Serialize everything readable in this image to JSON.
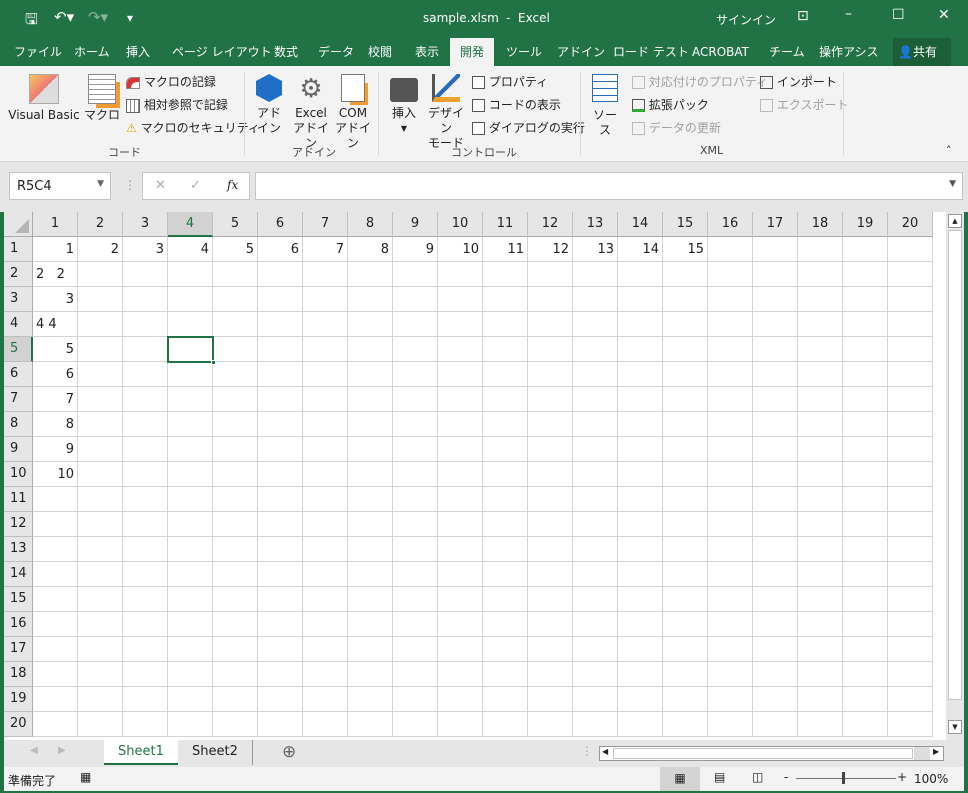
{
  "title": {
    "file": "sample.xlsm",
    "sep": "-",
    "app": "Excel",
    "signin": "サインイン"
  },
  "qat": {
    "save": "save-icon",
    "undo": "undo-icon",
    "redo": "redo-icon",
    "customize": "▾"
  },
  "tabs": [
    "ファイル",
    "ホーム",
    "挿入",
    "ページ レイアウト",
    "数式",
    "データ",
    "校閲",
    "表示",
    "開発",
    "ツール",
    "アドイン",
    "ロード テスト",
    "ACROBAT",
    "チーム",
    "操作アシス"
  ],
  "active_tab": "開発",
  "share": "共有",
  "ribbon": {
    "code": {
      "label": "コード",
      "visual_basic": "Visual Basic",
      "macro": "マクロ",
      "record": "マクロの記録",
      "relative": "相対参照で記録",
      "security": "マクロのセキュリティ"
    },
    "addins": {
      "label": "アドイン",
      "addin": [
        "アド",
        "イン"
      ],
      "excel_addin": [
        "Excel",
        "アドイン"
      ],
      "com_addin": [
        "COM",
        "アドイン"
      ]
    },
    "controls": {
      "label": "コントロール",
      "insert": "挿入",
      "design": [
        "デザイン",
        "モード"
      ],
      "properties": "プロパティ",
      "view_code": "コードの表示",
      "dialog": "ダイアログの実行"
    },
    "xml": {
      "label": "XML",
      "source": "ソース",
      "map_props": "対応付けのプロパティ",
      "expansion": "拡張パック",
      "refresh": "データの更新",
      "import": "インポート",
      "export": "エクスポート"
    }
  },
  "formula_bar": {
    "name_box": "R5C4",
    "fx": "fx",
    "cancel": "✕",
    "enter": "✓",
    "value": ""
  },
  "grid": {
    "columns": [
      "1",
      "2",
      "3",
      "4",
      "5",
      "6",
      "7",
      "8",
      "9",
      "10",
      "11",
      "12",
      "13",
      "14",
      "15",
      "16",
      "17",
      "18",
      "19",
      "20"
    ],
    "rows": [
      "1",
      "2",
      "3",
      "4",
      "5",
      "6",
      "7",
      "8",
      "9",
      "10",
      "11",
      "12",
      "13",
      "14",
      "15",
      "16",
      "17",
      "18",
      "19",
      "20"
    ],
    "selected": {
      "row": 5,
      "col": 4
    },
    "cells": [
      {
        "r": 1,
        "c": 1,
        "v": "1",
        "type": "num"
      },
      {
        "r": 1,
        "c": 2,
        "v": "2",
        "type": "num"
      },
      {
        "r": 1,
        "c": 3,
        "v": "3",
        "type": "num"
      },
      {
        "r": 1,
        "c": 4,
        "v": "4",
        "type": "num"
      },
      {
        "r": 1,
        "c": 5,
        "v": "5",
        "type": "num"
      },
      {
        "r": 1,
        "c": 6,
        "v": "6",
        "type": "num"
      },
      {
        "r": 1,
        "c": 7,
        "v": "7",
        "type": "num"
      },
      {
        "r": 1,
        "c": 8,
        "v": "8",
        "type": "num"
      },
      {
        "r": 1,
        "c": 9,
        "v": "9",
        "type": "num"
      },
      {
        "r": 1,
        "c": 10,
        "v": "10",
        "type": "num"
      },
      {
        "r": 1,
        "c": 11,
        "v": "11",
        "type": "num"
      },
      {
        "r": 1,
        "c": 12,
        "v": "12",
        "type": "num"
      },
      {
        "r": 1,
        "c": 13,
        "v": "13",
        "type": "num"
      },
      {
        "r": 1,
        "c": 14,
        "v": "14",
        "type": "num"
      },
      {
        "r": 1,
        "c": 15,
        "v": "15",
        "type": "num"
      },
      {
        "r": 2,
        "c": 1,
        "v": "2   2",
        "type": "text"
      },
      {
        "r": 3,
        "c": 1,
        "v": "3",
        "type": "num"
      },
      {
        "r": 4,
        "c": 1,
        "v": "4 4",
        "type": "text"
      },
      {
        "r": 5,
        "c": 1,
        "v": "5",
        "type": "num"
      },
      {
        "r": 6,
        "c": 1,
        "v": "6",
        "type": "num"
      },
      {
        "r": 7,
        "c": 1,
        "v": "7",
        "type": "num"
      },
      {
        "r": 8,
        "c": 1,
        "v": "8",
        "type": "num"
      },
      {
        "r": 9,
        "c": 1,
        "v": "9",
        "type": "num"
      },
      {
        "r": 10,
        "c": 1,
        "v": "10",
        "type": "num"
      }
    ]
  },
  "sheets": [
    "Sheet1",
    "Sheet2"
  ],
  "active_sheet": "Sheet1",
  "status": {
    "ready": "準備完了",
    "zoom": "100%",
    "zoom_minus": "-",
    "zoom_plus": "+"
  },
  "colors": {
    "accent": "#217346"
  }
}
